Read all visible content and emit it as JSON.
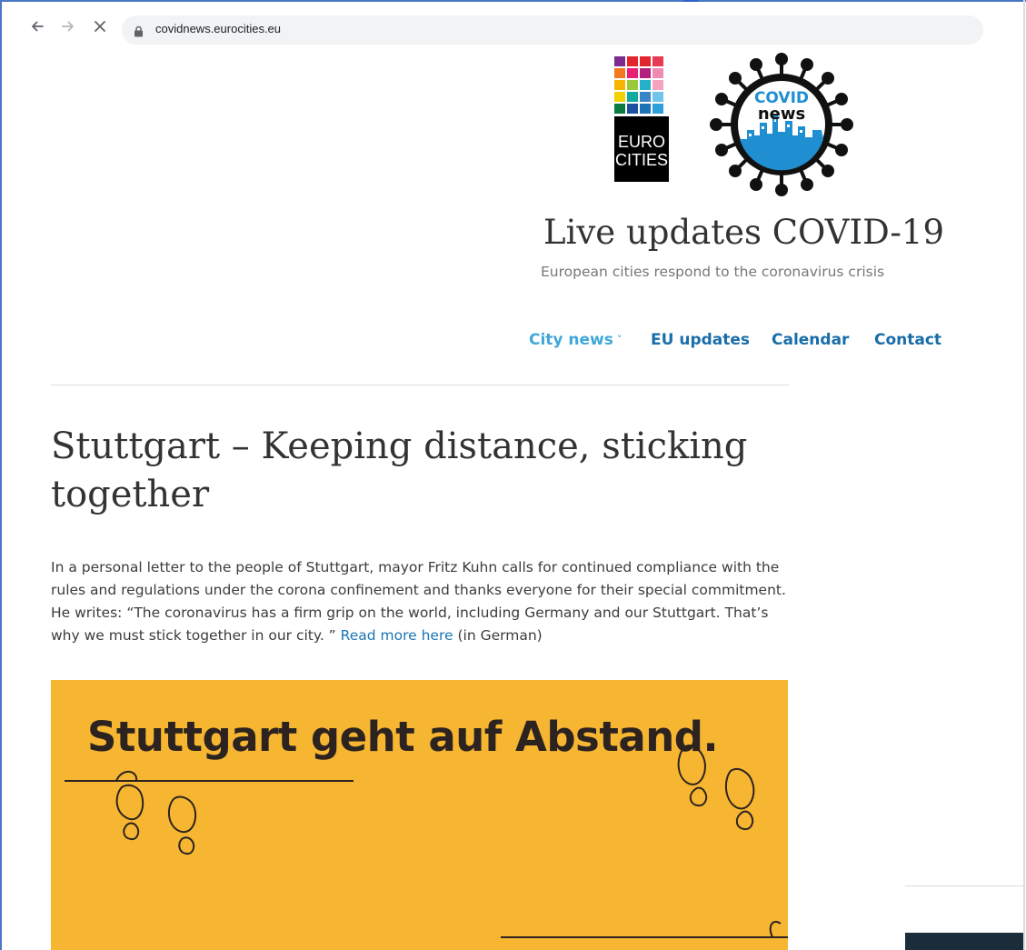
{
  "browser": {
    "url": "covidnews.eurocities.eu",
    "back_icon": "arrow-left-icon",
    "forward_icon": "arrow-right-icon",
    "stop_icon": "close-icon",
    "lock_icon": "lock-icon"
  },
  "header": {
    "eurocities_logo": {
      "line1": "EURO",
      "line2": "CITIES"
    },
    "covid_logo": {
      "line1": "COVID",
      "line2": "news"
    },
    "title": "Live updates COVID-19",
    "subtitle": "European cities respond to the coronavirus crisis"
  },
  "nav": {
    "items": [
      {
        "label": "City news",
        "has_dropdown": true,
        "active": true
      },
      {
        "label": "EU updates"
      },
      {
        "label": "Calendar"
      },
      {
        "label": "Contact"
      }
    ]
  },
  "article": {
    "title": "Stuttgart – Keeping distance, sticking together",
    "body": "In a personal letter to the people of Stuttgart, mayor Fritz Kuhn calls for continued compliance with the rules and regulations under the corona confinement and thanks everyone for their special commitment. He writes: “The coronavirus has a firm grip on the world, including Germany and our Stuttgart. That’s why we must stick together in our city. ” ",
    "link_text": "Read more here",
    "link_suffix": " (in German)",
    "banner_text": "Stuttgart geht auf Abstand."
  },
  "colors": {
    "link": "#196da8",
    "nav_active": "#40a7d8",
    "banner_bg": "#f6b631",
    "covid_blue": "#1f8fd1"
  }
}
